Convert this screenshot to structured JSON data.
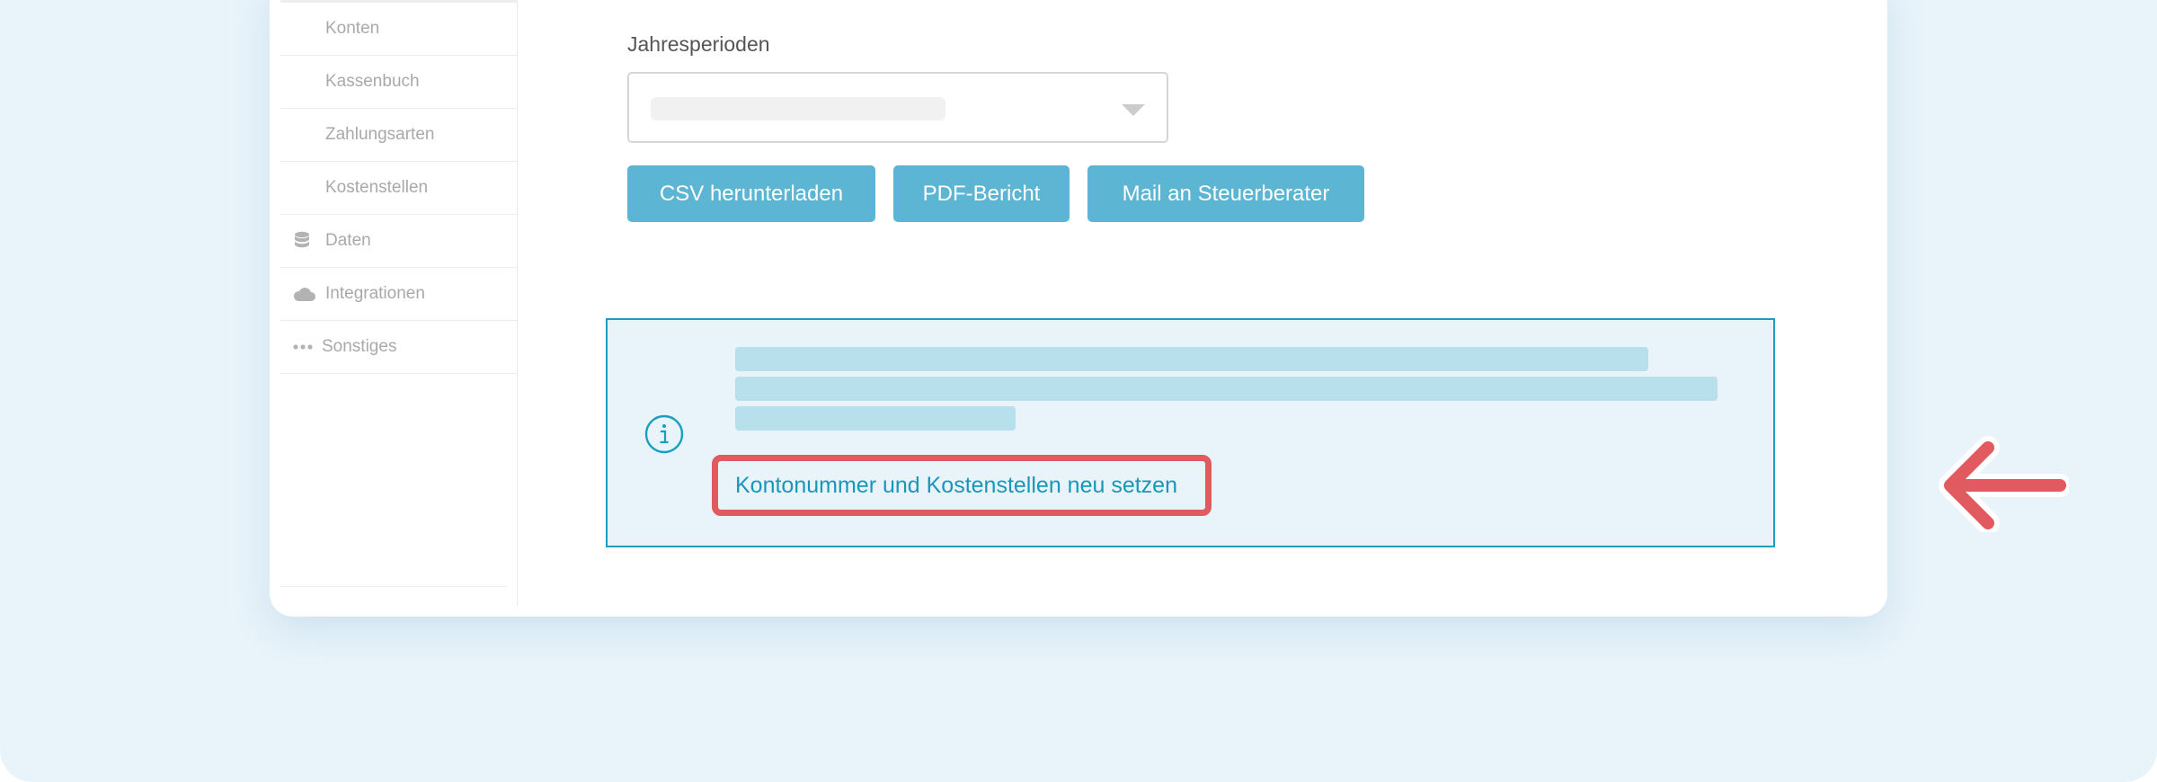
{
  "sidebar": {
    "items": [
      {
        "label": "Konten",
        "icon": ""
      },
      {
        "label": "Kassenbuch",
        "icon": ""
      },
      {
        "label": "Zahlungsarten",
        "icon": ""
      },
      {
        "label": "Kostenstellen",
        "icon": ""
      },
      {
        "label": "Daten",
        "icon": "database-icon"
      },
      {
        "label": "Integrationen",
        "icon": "cloud-icon"
      },
      {
        "label": "Sonstiges",
        "icon": "more-dots-icon"
      }
    ]
  },
  "main": {
    "period_label": "Jahresperioden",
    "buttons": {
      "csv": "CSV herunterladen",
      "pdf": "PDF-Bericht",
      "mail": "Mail an Steuerberater"
    },
    "info": {
      "icon": "info-icon",
      "link": "Kontonummer und Kostenstellen neu setzen"
    }
  },
  "annotation": {
    "arrow_icon": "pointer-arrow-left-icon",
    "highlight_color": "#e05a5f"
  },
  "colors": {
    "accent": "#5cb6d3",
    "info_border": "#1a9fbf",
    "link": "#1897b8",
    "background": "#e8f3fa"
  }
}
